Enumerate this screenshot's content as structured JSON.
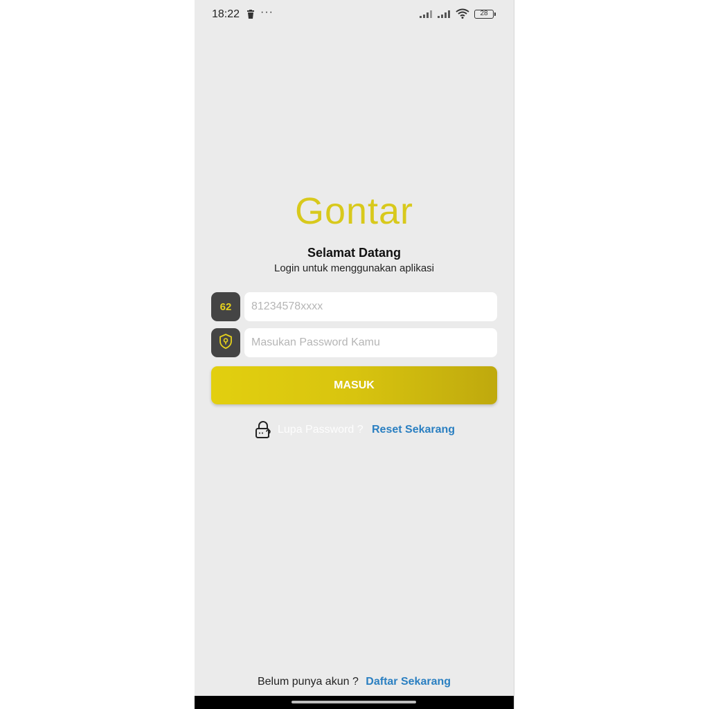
{
  "status_bar": {
    "time": "18:22",
    "dots": "···",
    "battery": "28",
    "icons": [
      "trash-icon",
      "signal-icon",
      "signal-icon",
      "wifi-icon",
      "battery-icon"
    ]
  },
  "app": {
    "logo": "Gontar",
    "welcome": "Selamat Datang",
    "subtitle": "Login untuk menggunakan aplikasi",
    "accent_color": "#d8c91c",
    "link_color": "#2a7fc1"
  },
  "login": {
    "country_code": "62",
    "phone_placeholder": "81234578xxxx",
    "password_placeholder": "Masukan Password Kamu",
    "submit_label": "MASUK",
    "forgot_text": "Lupa Password ?",
    "reset_link": "Reset Sekarang"
  },
  "register": {
    "text": "Belum punya akun ?",
    "link": "Daftar Sekarang"
  }
}
